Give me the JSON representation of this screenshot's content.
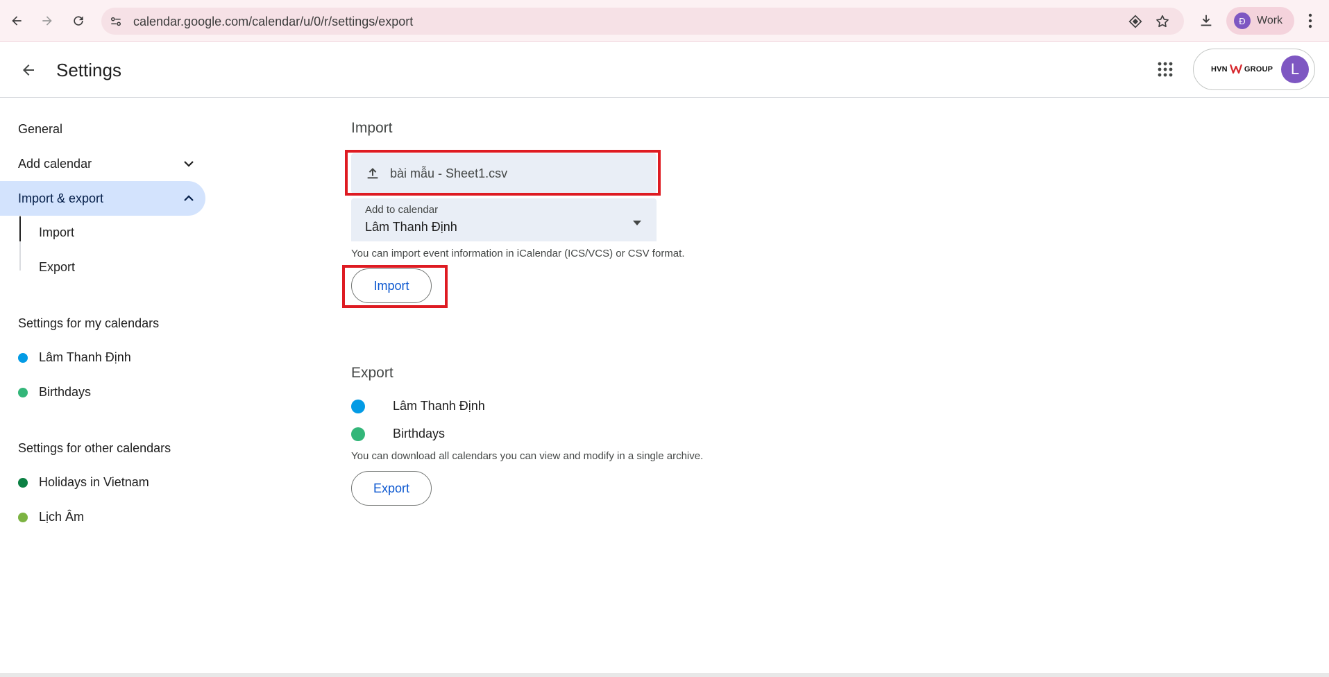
{
  "browser": {
    "url": "calendar.google.com/calendar/u/0/r/settings/export",
    "profile_initial": "Đ",
    "profile_name": "Work"
  },
  "header": {
    "title": "Settings",
    "org_logo_left": "HVN",
    "org_logo_right": "GROUP",
    "account_initial": "L"
  },
  "sidebar": {
    "general": "General",
    "add_calendar": "Add calendar",
    "import_export": "Import & export",
    "import": "Import",
    "export": "Export",
    "my_calendars_heading": "Settings for my calendars",
    "my_calendars": [
      {
        "name": "Lâm Thanh Định",
        "color": "#039be5"
      },
      {
        "name": "Birthdays",
        "color": "#33b679"
      }
    ],
    "other_calendars_heading": "Settings for other calendars",
    "other_calendars": [
      {
        "name": "Holidays in Vietnam",
        "color": "#0b8043"
      },
      {
        "name": "Lịch Âm",
        "color": "#7cb342"
      }
    ]
  },
  "import_section": {
    "title": "Import",
    "file_name": "bài mẫu - Sheet1.csv",
    "calendar_label": "Add to calendar",
    "calendar_value": "Lâm Thanh Định",
    "help": "You can import event information in iCalendar (ICS/VCS) or CSV format.",
    "button": "Import"
  },
  "export_section": {
    "title": "Export",
    "calendars": [
      {
        "name": "Lâm Thanh Định",
        "color": "#039be5"
      },
      {
        "name": "Birthdays",
        "color": "#33b679"
      }
    ],
    "help": "You can download all calendars you can view and modify in a single archive.",
    "button": "Export"
  },
  "colors": {
    "highlight": "#de1b22",
    "accent": "#0b57d0",
    "active_nav": "#d3e3fd"
  }
}
